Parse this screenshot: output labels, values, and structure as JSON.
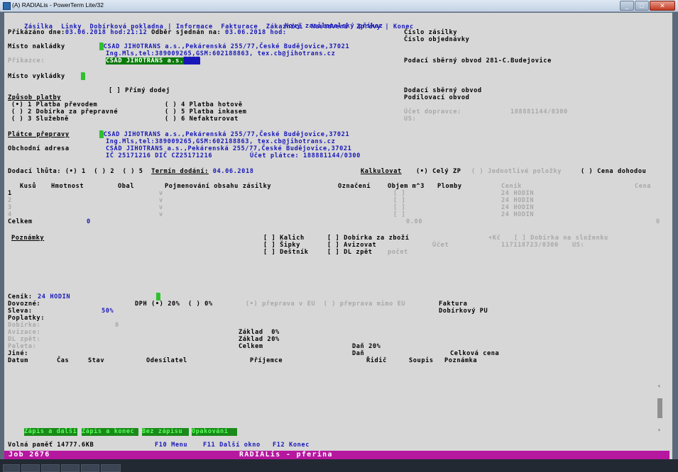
{
  "window": {
    "title": "(A) RADIALis - PowerTerm Lite/32"
  },
  "menu": {
    "items": [
      "Zásilka",
      "Linky",
      "Dobírková pokladna",
      "|",
      "Informace",
      "Fakturace",
      "Zákazníci",
      "Nastavení",
      "Zprávy",
      "|",
      "Konec"
    ]
  },
  "header": {
    "form_title": "Nový zasilatelský příkaz",
    "prikazano_label": "Přikázáno dne:",
    "prikazano_value": "03.06.2018 hod:21:12",
    "odber_label": "Odběr sjednán na:",
    "odber_value": "03.06.2018 hod:",
    "cislo_zasilky": "Číslo zásilky",
    "cislo_objednavky": "Číslo objednávky"
  },
  "nakladka": {
    "label": "Místo nakládky",
    "line1": "CSAD JIHOTRANS a.s.,Pekárenská 255/77,České Budějovice,37021",
    "line2": "Ing.Mls,tel:389009265,GSM:602188863, tex.cb@jihotrans.cz",
    "prikazce_label": "Příkazce:",
    "prikazce_value": "CSAD JIHOTRANS a.s.",
    "podaci_obvod": "Podací sběrný obvod 281-C.Budejovice"
  },
  "vykladka": {
    "label": "Místo vykládky"
  },
  "platba": {
    "primy_dodej": "[ ] Přímý dodej",
    "zpusob_label": "Způsob platby",
    "opt1": "(•) 1 Platba převodem",
    "opt2": "( ) 2 Dobírka za přepravné",
    "opt3": "( ) 3 Služebně",
    "opt4": "( ) 4 Platba hotově",
    "opt5": "( ) 5 Platba inkasem",
    "opt6": "( ) 6 Nefakturovat",
    "dodaci_obvod": "Dodací sběrný obvod",
    "podilovaci_obvod": "Podílovací obvod",
    "ucet_dopravce_label": "Účet dopravce:",
    "ucet_dopravce_value": "188881144/0300",
    "us": "US:"
  },
  "platce": {
    "label": "Plátce přepravy",
    "line1": "CSAD JIHOTRANS a.s.,Pekárenská 255/77,České Budějovice,37021",
    "line2": "Ing.Mls,tel:389009265,GSM:602188863, tex.cb@jihotrans.cz",
    "obchodni_label": "Obchodní adresa",
    "obchodni_line1": "CSAD JIHOTRANS a.s.,Pekárenská 255/77,České Budějovice,37021",
    "ic_line": "IČ 25171216 DIČ CZ25171216",
    "ucet_platce": "Účet plátce: 188881144/0300"
  },
  "dodaci": {
    "lhuta_label": "Dodací lhůta:",
    "lhuta_opts": "(•) 1  ( ) 2  ( ) 5",
    "termin_label": "Termín dodání:",
    "termin_value": "04.06.2018",
    "kalkulovat_label": "Kalkulovat",
    "opt_cely": "(•) Celý ZP",
    "opt_jednotlive": "( ) Jednotlivé položky",
    "opt_cena": "( ) Cena dohodou"
  },
  "table": {
    "headers": [
      "Kusů",
      "Hmotnost",
      "Obal",
      "Pojmenování obsahu zásilky",
      "Označení",
      "Objem m^3",
      "Plomby",
      "Ceník",
      "Cena"
    ],
    "rows": [
      {
        "num": "1",
        "v": "v",
        "objem": "[ ]",
        "cenik": "24 HODIN"
      },
      {
        "num": "2",
        "v": "v",
        "objem": "[ ]",
        "cenik": "24 HODIN"
      },
      {
        "num": "3",
        "v": "v",
        "objem": "[ ]",
        "cenik": "24 HODIN"
      },
      {
        "num": "4",
        "v": "v",
        "objem": "[ ]",
        "cenik": "24 HODIN"
      }
    ],
    "total_label": "Celkem",
    "total_value": "0",
    "total_objem": "0.00",
    "total_cena": "0"
  },
  "options": {
    "poznamky": "Poznámky",
    "kalich": "[ ] Kalich",
    "sipky": "[ ] Šipky",
    "destnik": "[ ] Deštník",
    "dobirka_zbozi": "[ ] Dobírka za zboží",
    "avizovat": "[ ] Avizovat",
    "dl_zpet": "[ ] DL zpět",
    "pocet": "počet",
    "kc": "+Kč",
    "ucet": "Účet",
    "dobirka_slozenku": "[ ] Dobírka na složenku",
    "ucet_value": "117118723/0300",
    "us": "US:"
  },
  "summary": {
    "cenik_label": "Ceník:",
    "cenik_value": "24 HODIN",
    "dovozne": "Dovozné:",
    "dph": "DPH (•) 20%  ( ) 0%",
    "preprava_eu": "(•) přeprava v EU  ( ) přeprava mimo EU",
    "faktura": "Faktura",
    "sleva_label": "Sleva:",
    "sleva_value": "50%",
    "dobirkovy_pu": "Dobírkový PU",
    "poplatky": "Poplatky:",
    "dobirka": "Dobírka:",
    "dobirka_value": "0",
    "avizace": "Avizace:",
    "dl_zpet": "DL zpět:",
    "paleta": "Paleta:",
    "jine": "Jiné:",
    "zaklad0": "Základ  0%",
    "zaklad20": "Základ 20%",
    "celkem": "Celkem",
    "dan20": "Daň 20%",
    "dan": "Daň",
    "celkova_cena": "Celková cena"
  },
  "history": {
    "headers": [
      "Datum",
      "Čas",
      "Stav",
      "Odesílatel",
      "Příjemce",
      "Řidič",
      "Soupis",
      "Poznámka"
    ]
  },
  "buttons": [
    {
      "label": "Zápis a další"
    },
    {
      "label": "Zápis a konec"
    },
    {
      "label": "Bez zápisu"
    },
    {
      "label": "Opakování"
    }
  ],
  "footer": {
    "memory": "Volná paměť 14777.6KB",
    "f10": "F10 Menu",
    "f11": "F11 Další okno",
    "f12": "F12 Konec"
  },
  "statusbar": {
    "job": "Job 2676",
    "app": "RADIALis - pferina"
  }
}
